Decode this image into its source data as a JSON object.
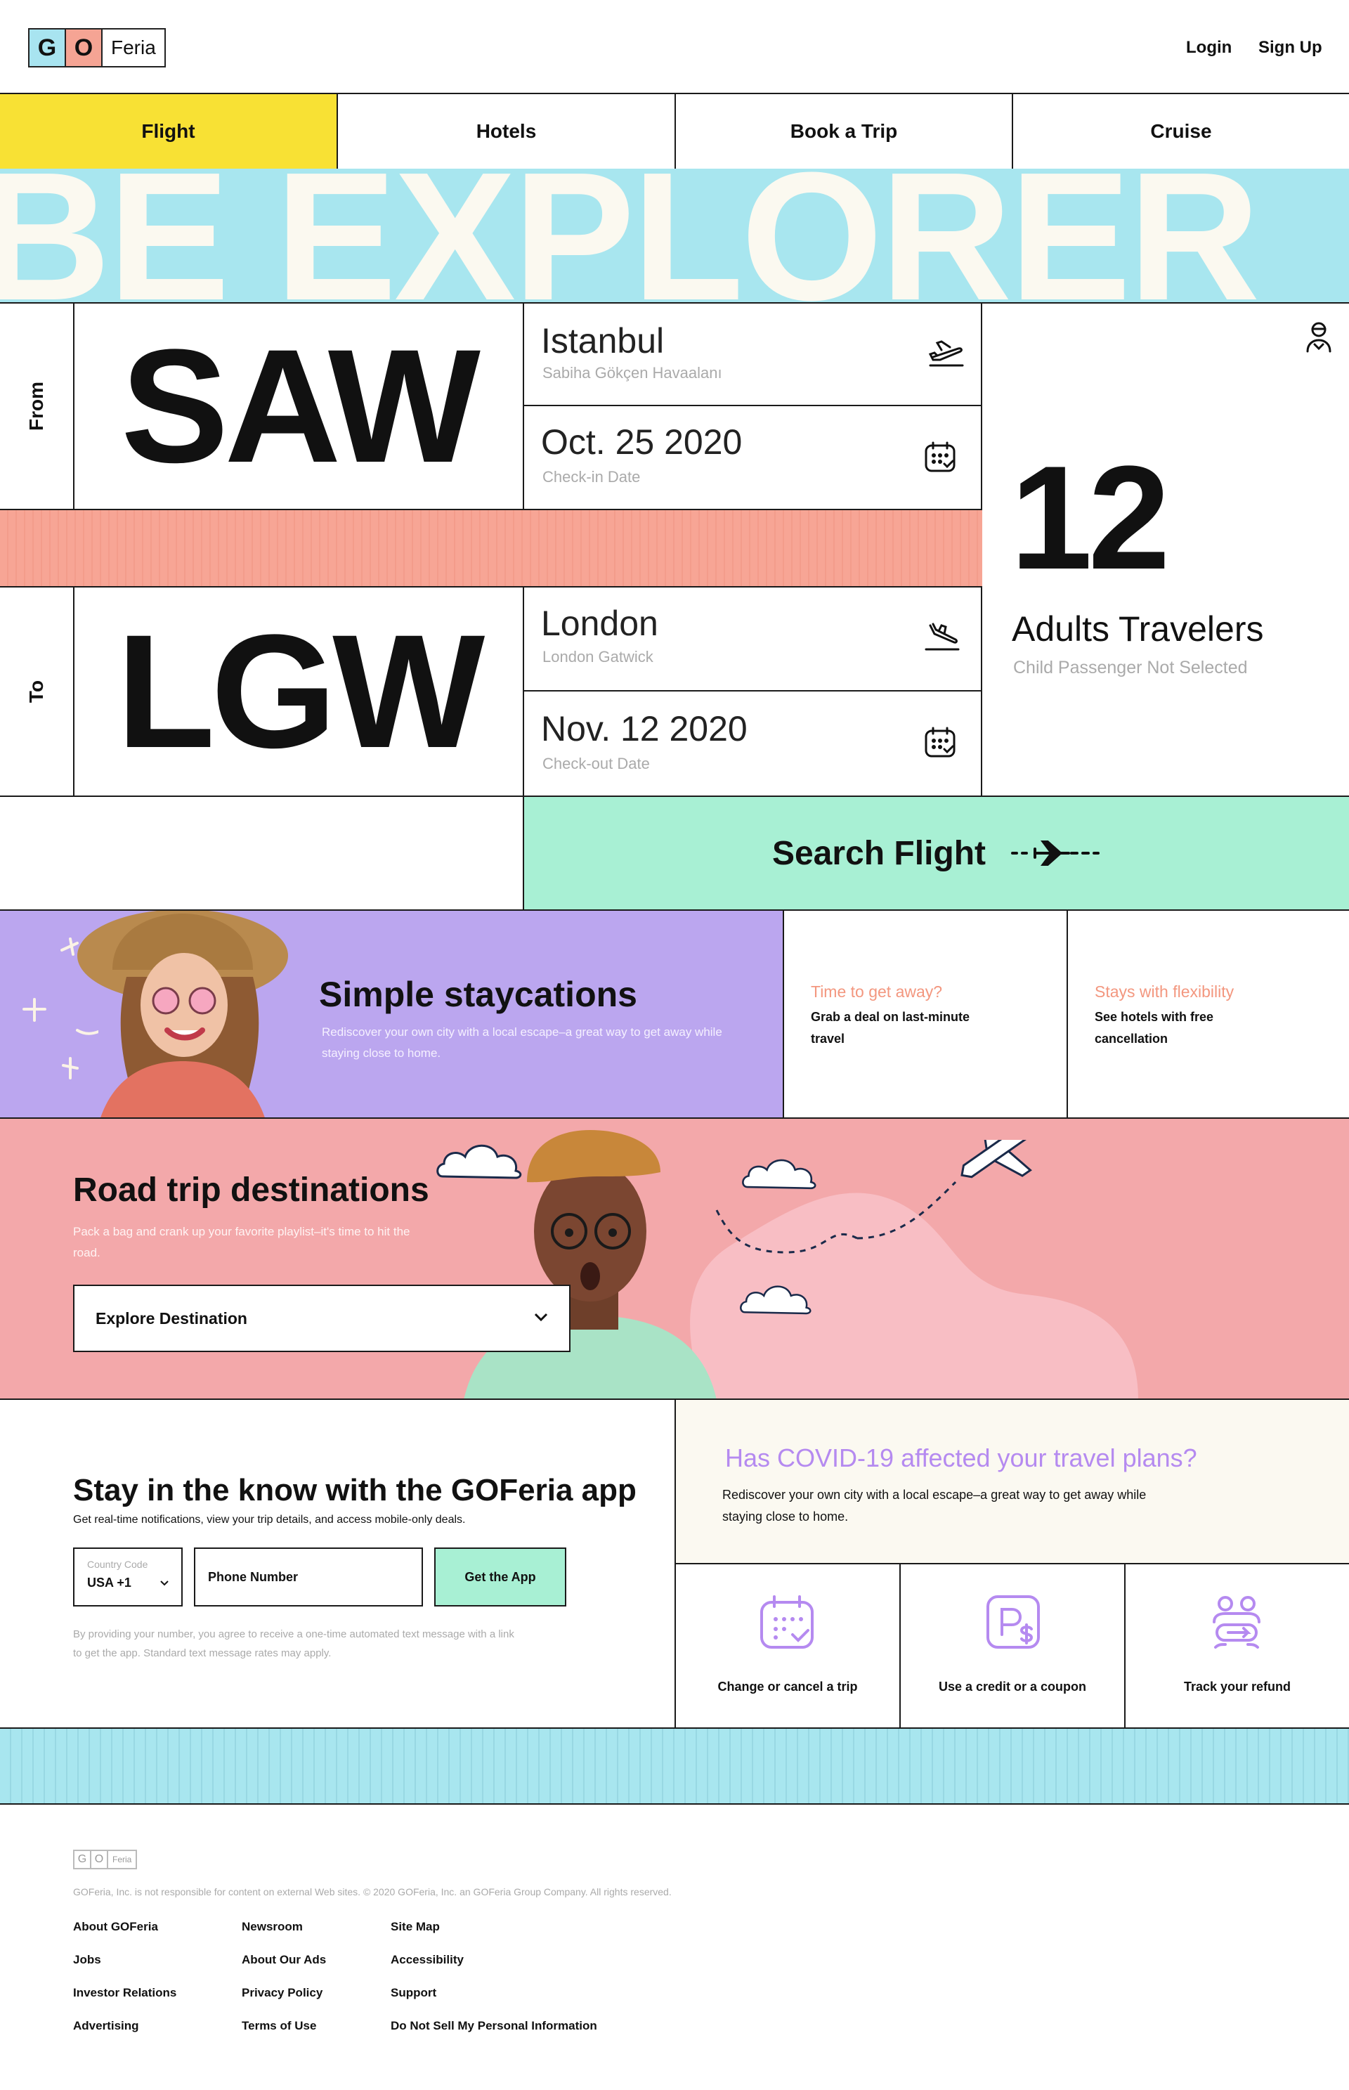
{
  "header": {
    "logo": {
      "g": "G",
      "o": "O",
      "name": "Feria"
    },
    "login": "Login",
    "signup": "Sign Up"
  },
  "tabs": [
    {
      "label": "Flight"
    },
    {
      "label": "Hotels"
    },
    {
      "label": "Book a Trip"
    },
    {
      "label": "Cruise"
    }
  ],
  "banner": "BE EXPLORER",
  "from": {
    "label": "From",
    "code": "SAW",
    "city": "Istanbul",
    "airport": "Sabiha Gökçen Havaalanı",
    "date": "Oct. 25 2020",
    "date_label": "Check-in Date"
  },
  "to": {
    "label": "To",
    "code": "LGW",
    "city": "London",
    "airport": "London Gatwick",
    "date": "Nov. 12 2020",
    "date_label": "Check-out Date"
  },
  "travelers": {
    "count": "12",
    "label": "Adults Travelers",
    "sub": "Child Passenger Not Selected"
  },
  "search_button": "Search Flight",
  "staycation": {
    "title": "Simple staycations",
    "text": "Rediscover your own city with a local escape–a great way to get away while staying close to home."
  },
  "promo1": {
    "title": "Time to get away?",
    "text": "Grab a deal on last-minute travel"
  },
  "promo2": {
    "title": "Stays with flexibility",
    "text": "See hotels with free cancellation"
  },
  "roadtrip": {
    "title": "Road trip destinations",
    "text": "Pack a bag and crank up your favorite playlist–it's time to hit the road.",
    "select": "Explore Destination"
  },
  "app": {
    "title": "Stay in the know with the GOFeria app",
    "text": "Get real-time notifications, view your trip details, and access mobile-only deals.",
    "country_label": "Country Code",
    "country_value": "USA +1",
    "phone_placeholder": "Phone Number",
    "button": "Get the App",
    "disclaimer": "By providing your number, you agree to receive a one-time automated text message with a link to get the app. Standard text message rates may apply."
  },
  "covid": {
    "title": "Has COVID-19 affected your travel plans?",
    "text": "Rediscover your own city with a local escape–a great way to get away while staying close to home."
  },
  "services": [
    {
      "label": "Change or cancel a trip"
    },
    {
      "label": "Use a credit or a coupon"
    },
    {
      "label": "Track your refund"
    }
  ],
  "footer": {
    "logo": {
      "g": "G",
      "o": "O",
      "name": "Feria"
    },
    "legal": "GOFeria, Inc. is not responsible for content on external Web sites. © 2020 GOFeria, Inc. an GOFeria Group Company. All rights reserved.",
    "col1": [
      "About GOFeria",
      "Jobs",
      "Investor Relations",
      "Advertising"
    ],
    "col2": [
      "Newsroom",
      "About Our Ads",
      "Privacy Policy",
      "Terms of Use"
    ],
    "col3": [
      "Site Map",
      "Accessibility",
      "Support",
      "Do Not Sell My Personal Information"
    ]
  },
  "colors": {
    "yellow": "#f8e134",
    "cyan": "#a8e6ef",
    "salmon": "#f7a595",
    "mint": "#a8f0d4",
    "purple": "#bba6ef",
    "pink": "#f3a8aa",
    "purple_text": "#b58af0"
  }
}
